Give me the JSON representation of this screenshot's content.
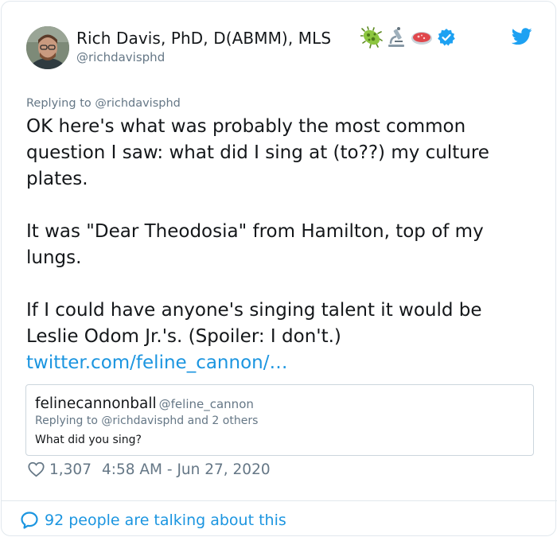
{
  "author": {
    "display_name": "Rich Davis, PhD, D(ABMM), MLS",
    "handle": "@richdavisphd",
    "emojis": [
      "microbe-icon",
      "microscope-icon",
      "petri-dish-icon"
    ],
    "verified": true
  },
  "tweet": {
    "replying_prefix": "Replying to ",
    "replying_to": "@richdavisphd",
    "paragraphs": [
      "OK here's what was probably the most common\nquestion I saw: what did I sing at (to??) my culture\nplates.",
      "It was \"Dear Theodosia\" from Hamilton, top of my\nlungs.",
      "If I could have anyone's singing talent it would be\nLeslie Odom Jr.'s. (Spoiler: I don't.)"
    ],
    "link_text": "twitter.com/feline_cannon/…"
  },
  "quoted_tweet": {
    "display_name": "felinecannonball",
    "handle": "@feline_cannon",
    "replying": "Replying to @richdavisphd and 2 others",
    "text": "What did you sing?"
  },
  "stats": {
    "likes": "1,307",
    "timestamp": "4:58 AM - Jun 27, 2020"
  },
  "footer": {
    "talking": "92 people are talking about this"
  },
  "colors": {
    "link": "#1b95e0",
    "secondary_text": "#657786",
    "border": "#e1e8ed",
    "verified": "#1da1f2"
  }
}
